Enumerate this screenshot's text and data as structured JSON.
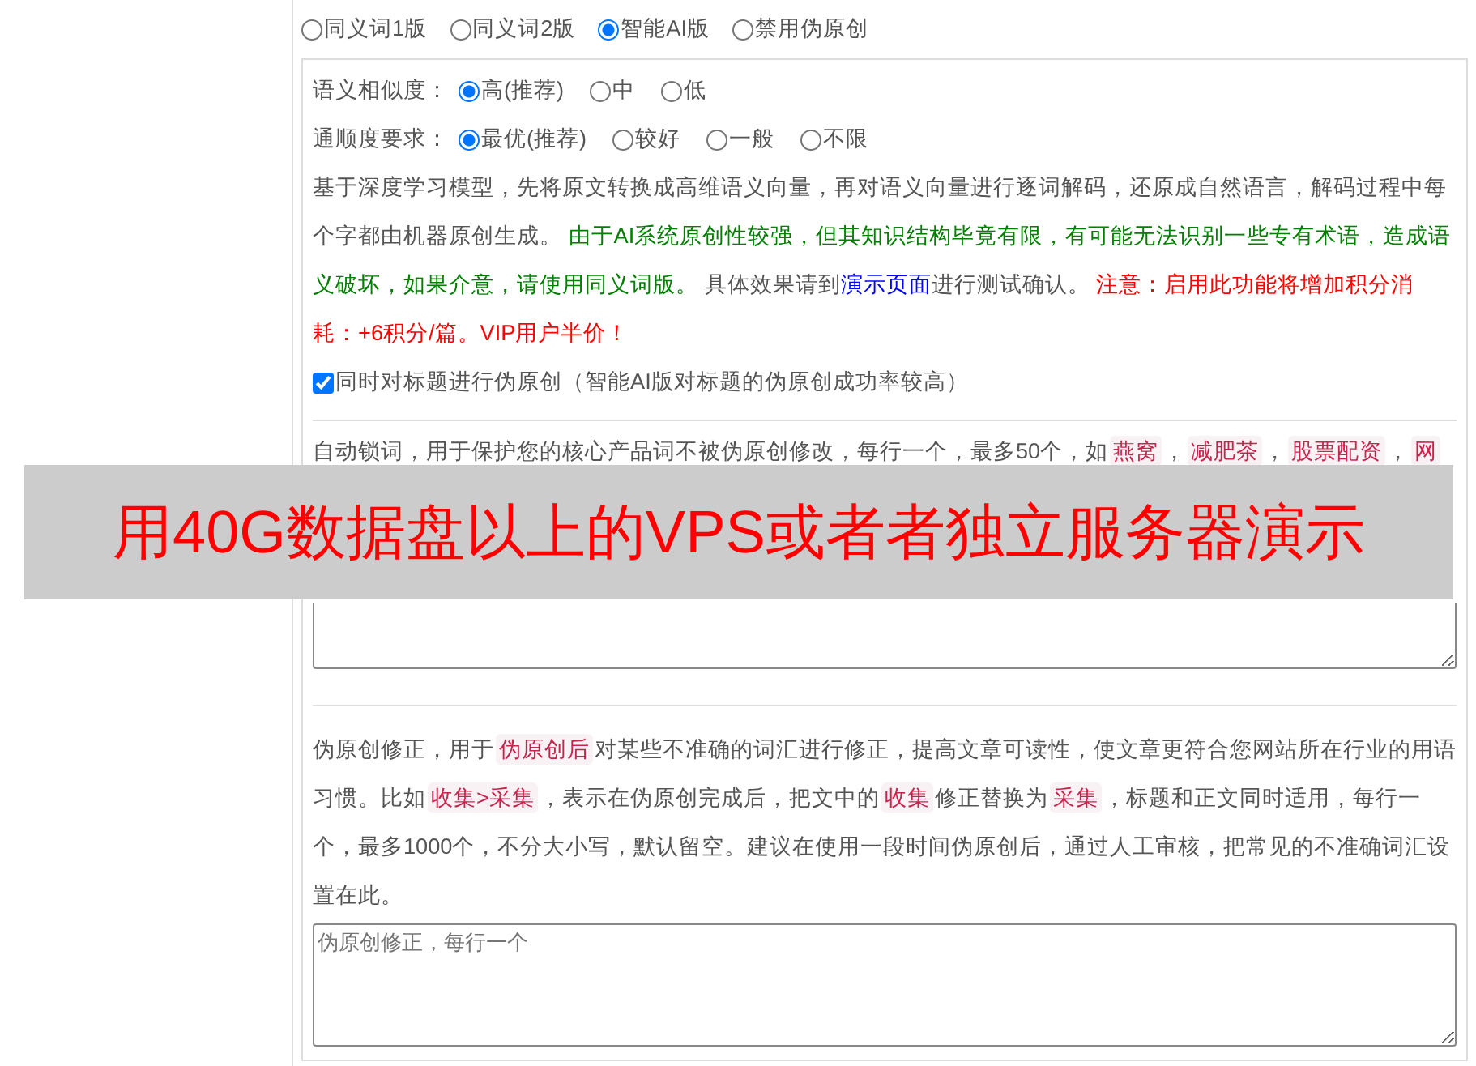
{
  "mode_options": [
    {
      "label": "同义词1版",
      "selected": false
    },
    {
      "label": "同义词2版",
      "selected": false
    },
    {
      "label": "智能AI版",
      "selected": true
    },
    {
      "label": "禁用伪原创",
      "selected": false
    }
  ],
  "settings": [
    {
      "label": "语义相似度：",
      "options": [
        {
          "label": "高(推荐)",
          "selected": true
        },
        {
          "label": "中",
          "selected": false
        },
        {
          "label": "低",
          "selected": false
        }
      ]
    },
    {
      "label": "通顺度要求：",
      "options": [
        {
          "label": "最优(推荐)",
          "selected": true
        },
        {
          "label": "较好",
          "selected": false
        },
        {
          "label": "一般",
          "selected": false
        },
        {
          "label": "不限",
          "selected": false
        }
      ]
    }
  ],
  "ai_description": [
    {
      "kind": "plain",
      "text": "基于深度学习模型，先将原文转换成高维语义向量，再对语义向量进行逐词解码，还原成自然语言，解码过程中每个字都由机器原创生成。 "
    },
    {
      "kind": "green",
      "text": "由于AI系统原创性较强，但其知识结构毕竟有限，有可能无法识别一些专有术语，造成语义破坏，如果介意，请使用同义词版。"
    },
    {
      "kind": "plain",
      "text": " 具体效果请到"
    },
    {
      "kind": "link",
      "text": "演示页面"
    },
    {
      "kind": "plain",
      "text": "进行测试确认。 "
    },
    {
      "kind": "red",
      "text": "注意：启用此功能将增加积分消耗：+6积分/篇。VIP用户半价！"
    }
  ],
  "title_checkbox": {
    "label": "同时对标题进行伪原创（智能AI版对标题的伪原创成功率较高）",
    "checked": true
  },
  "locked_words": {
    "description": [
      {
        "kind": "plain",
        "text": "自动锁词，用于保护您的核心产品词不被伪原创修改，每行一个，最多50个，如"
      },
      {
        "kind": "tag",
        "text": "燕窝"
      },
      {
        "kind": "plain",
        "text": "，"
      },
      {
        "kind": "tag",
        "text": "减肥茶"
      },
      {
        "kind": "plain",
        "text": "，"
      },
      {
        "kind": "tag",
        "text": "股票配资"
      },
      {
        "kind": "plain",
        "text": "，"
      },
      {
        "kind": "tag",
        "text": "网"
      }
    ]
  },
  "corrections": {
    "description": [
      {
        "kind": "plain",
        "text": "伪原创修正，用于"
      },
      {
        "kind": "tag",
        "text": "伪原创后"
      },
      {
        "kind": "plain",
        "text": "对某些不准确的词汇进行修正，提高文章可读性，使文章更符合您网站所在行业的用语习惯。比如"
      },
      {
        "kind": "tag",
        "text": "收集>采集"
      },
      {
        "kind": "plain",
        "text": "，表示在伪原创完成后，把文中的"
      },
      {
        "kind": "tag",
        "text": "收集"
      },
      {
        "kind": "plain",
        "text": "修正替换为"
      },
      {
        "kind": "tag",
        "text": "采集"
      },
      {
        "kind": "plain",
        "text": "，标题和正文同时适用，每行一个，最多1000个，不分大小写，默认留空。建议在使用一段时间伪原创后，通过人工审核，把常见的不准确词汇设置在此。"
      }
    ],
    "placeholder": "伪原创修正，每行一个"
  },
  "overlay_banner": "用40G数据盘以上的VPS或者者独立服务器演示"
}
